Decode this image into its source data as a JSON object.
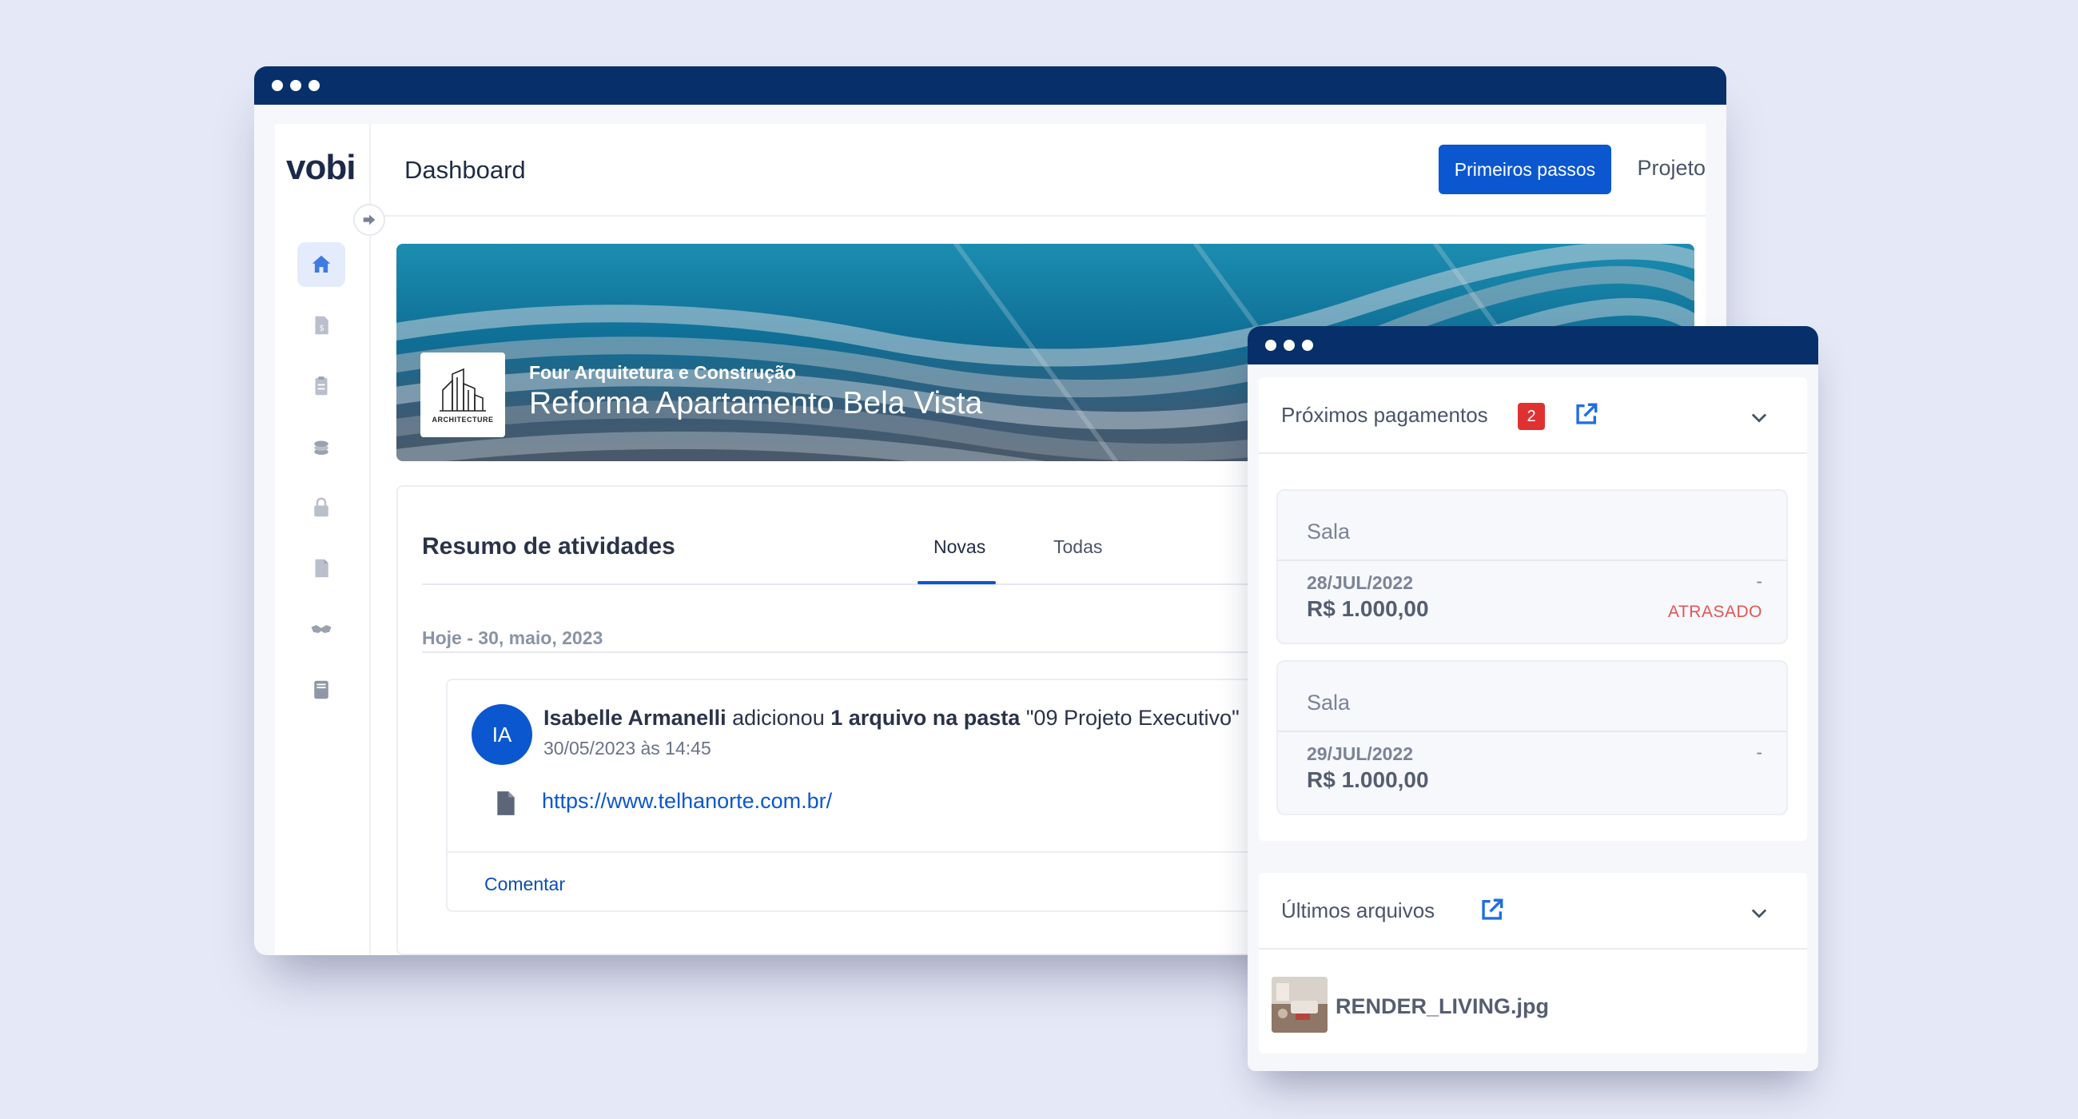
{
  "main_window": {
    "logo": "vobi",
    "page_title": "Dashboard",
    "primary_button": "Primeiros passos",
    "top_link": "Projeto",
    "sidebar_icons": [
      "home-icon",
      "invoice-icon",
      "clipboard-icon",
      "coins-icon",
      "lock-icon",
      "document-icon",
      "handshake-icon",
      "book-icon"
    ],
    "banner": {
      "logo_caption": "ARCHITECTURE",
      "company": "Four Arquitetura e Construção",
      "project": "Reforma Apartamento Bela Vista"
    },
    "activity": {
      "title": "Resumo de atividades",
      "tabs": [
        "Novas",
        "Todas"
      ],
      "active_tab": "Novas",
      "date_label": "Hoje - 30, maio, 2023",
      "item": {
        "avatar_initials": "IA",
        "user": "Isabelle Armanelli",
        "action": "adicionou",
        "object": "1 arquivo na pasta",
        "folder": "\"09 Projeto Executivo\"",
        "timestamp": "30/05/2023 às 14:45",
        "link": "https://www.telhanorte.com.br/",
        "comment_label": "Comentar"
      }
    }
  },
  "side_window": {
    "payments": {
      "title": "Próximos pagamentos",
      "count": "2",
      "items": [
        {
          "name": "Sala",
          "date": "28/JUL/2022",
          "dash": "-",
          "value": "R$ 1.000,00",
          "status": "ATRASADO"
        },
        {
          "name": "Sala",
          "date": "29/JUL/2022",
          "dash": "-",
          "value": "R$ 1.000,00",
          "status": ""
        }
      ]
    },
    "files": {
      "title": "Últimos arquivos",
      "items": [
        {
          "name": "RENDER_LIVING.jpg"
        }
      ]
    }
  },
  "colors": {
    "titlebar": "#07306a",
    "primary": "#0b57cf",
    "badge": "#e03131",
    "overdue": "#e25555",
    "background": "#e5e8f6"
  }
}
